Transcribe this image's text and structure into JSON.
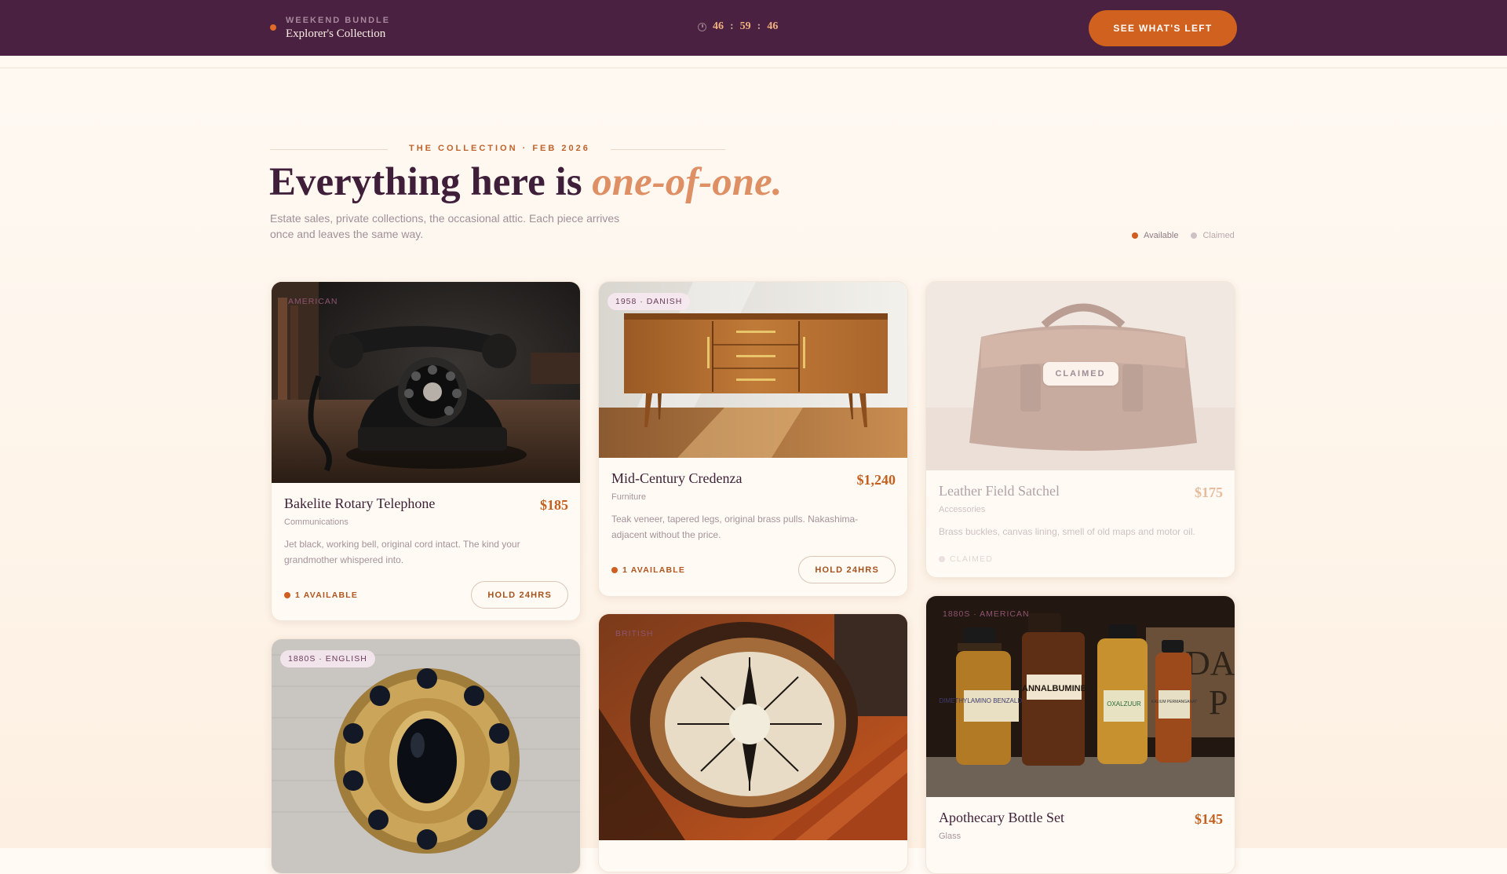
{
  "topbar": {
    "kicker": "WEEKEND BUNDLE",
    "title": "Explorer's Collection",
    "timer": {
      "h": "46",
      "m": "59",
      "s": "46",
      "sep": ":"
    },
    "cta": "SEE WHAT'S LEFT"
  },
  "header": {
    "eyebrow": "THE COLLECTION · FEB 2026",
    "headline_main": "Everything here is ",
    "headline_accent": "one-of-one.",
    "lede": "Estate sales, private collections, the occasional attic. Each piece arrives once and leaves the same way.",
    "legend": {
      "available": "Available",
      "claimed": "Claimed"
    }
  },
  "colors": {
    "topbar": "#4a2140",
    "accent": "#d0611f",
    "accent_soft": "#df8f64",
    "available": "#cf5e20",
    "claimed": "#cfc2c6"
  },
  "cards": [
    {
      "tag": "AMERICAN",
      "name": "Bakelite Rotary Telephone",
      "price": "$185",
      "category": "Communications",
      "description": "Jet black, working bell, original cord intact. The kind your grandmother whispered into.",
      "availability": "1 AVAILABLE",
      "hold": "HOLD 24HRS",
      "image": "rotary-telephone-photo"
    },
    {
      "tag": "1958 · DANISH",
      "name": "Mid-Century Credenza",
      "price": "$1,240",
      "category": "Furniture",
      "description": "Teak veneer, tapered legs, original brass pulls. Nakashima-adjacent without the price.",
      "availability": "1 AVAILABLE",
      "hold": "HOLD 24HRS",
      "image": "credenza-photo"
    },
    {
      "name": "Leather Field Satchel",
      "price": "$175",
      "category": "Accessories",
      "description": "Brass buckles, canvas lining, smell of old maps and motor oil.",
      "availability": "CLAIMED",
      "overlay": "CLAIMED",
      "image": "leather-satchel-photo"
    },
    {
      "tag": "1880S · ENGLISH",
      "image": "brooch-photo"
    },
    {
      "tag": "BRITISH",
      "image": "compass-photo"
    },
    {
      "tag": "1880S · AMERICAN",
      "name": "Apothecary Bottle Set",
      "price": "$145",
      "category": "Glass",
      "image": "apothecary-bottles-photo",
      "bottle_labels": [
        "DIMETHYLAMINO BENZALDEHYDE",
        "ANNALBUMINE",
        "OXALZUUR",
        "KALIUM PERMANGANAT",
        "DAR",
        "P"
      ]
    }
  ]
}
